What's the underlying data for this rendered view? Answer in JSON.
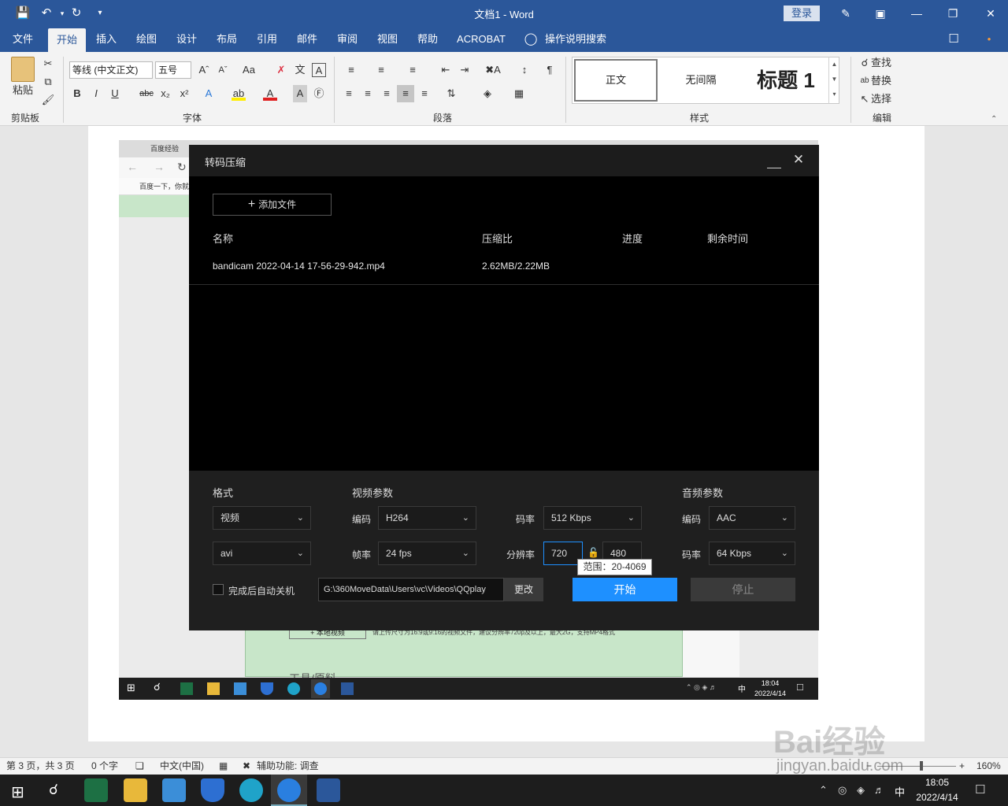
{
  "window": {
    "title": "文档1  -  Word",
    "login": "登录"
  },
  "menu": {
    "tabs": [
      "文件",
      "开始",
      "插入",
      "绘图",
      "设计",
      "布局",
      "引用",
      "邮件",
      "审阅",
      "视图",
      "帮助",
      "ACROBAT"
    ],
    "tell_me": "操作说明搜索"
  },
  "ribbon": {
    "paste": "粘贴",
    "font_name": "等线 (中文正文)",
    "font_size": "五号",
    "groups": {
      "clipboard": "剪贴板",
      "font": "字体",
      "paragraph": "段落",
      "styles": "样式",
      "editing": "编辑"
    },
    "styles": [
      "正文",
      "无间隔",
      "标题 1"
    ],
    "editing": {
      "find": "查找",
      "replace": "替换",
      "select": "选择"
    }
  },
  "dialog": {
    "title": "转码压缩",
    "add_file": "添加文件",
    "columns": {
      "name": "名称",
      "ratio": "压缩比",
      "progress": "进度",
      "remaining": "剩余时间"
    },
    "files": [
      {
        "name": "bandicam 2022-04-14 17-56-29-942.mp4",
        "ratio": "2.62MB/2.22MB",
        "progress": "",
        "remaining": ""
      }
    ],
    "format": {
      "label": "格式",
      "type": "视频",
      "container": "avi"
    },
    "video": {
      "label": "视频参数",
      "codec_label": "编码",
      "codec": "H264",
      "fps_label": "帧率",
      "fps": "24 fps",
      "bitrate_label": "码率",
      "bitrate": "512 Kbps",
      "resolution_label": "分辨率",
      "width": "720",
      "height": "480",
      "tooltip": "范围：20-4069"
    },
    "audio": {
      "label": "音频参数",
      "codec_label": "编码",
      "codec": "AAC",
      "bitrate_label": "码率",
      "bitrate": "64 Kbps"
    },
    "shutdown_label": "完成后自动关机",
    "path": "G:\\360MoveData\\Users\\vc\\Videos\\QQplay",
    "change": "更改",
    "start": "开始",
    "stop": "停止"
  },
  "background_shot": {
    "bookmark": "百度一下，你就知道",
    "tab": "百度经验",
    "local_video": "+ 本地视频",
    "upload_hint": "请上传尺寸为16:9或9:16的视频文件，建议分辨率720p及以上，最大2G，支持MP4格式",
    "tool_material": "工具/原料",
    "clock_time": "18:04",
    "clock_date": "2022/4/14",
    "ime": "中"
  },
  "statusbar": {
    "page": "第 3 页，共 3 页",
    "words": "0 个字",
    "language": "中文(中国)",
    "accessibility": "辅助功能: 调查",
    "zoom": "160%"
  },
  "taskbar": {
    "time": "18:05",
    "date": "2022/4/14",
    "ime": "中"
  },
  "watermark": {
    "brand": "Bai经验",
    "url": "jingyan.baidu.com"
  },
  "colors": {
    "word_blue": "#2b579a",
    "start_button": "#1e90ff"
  }
}
